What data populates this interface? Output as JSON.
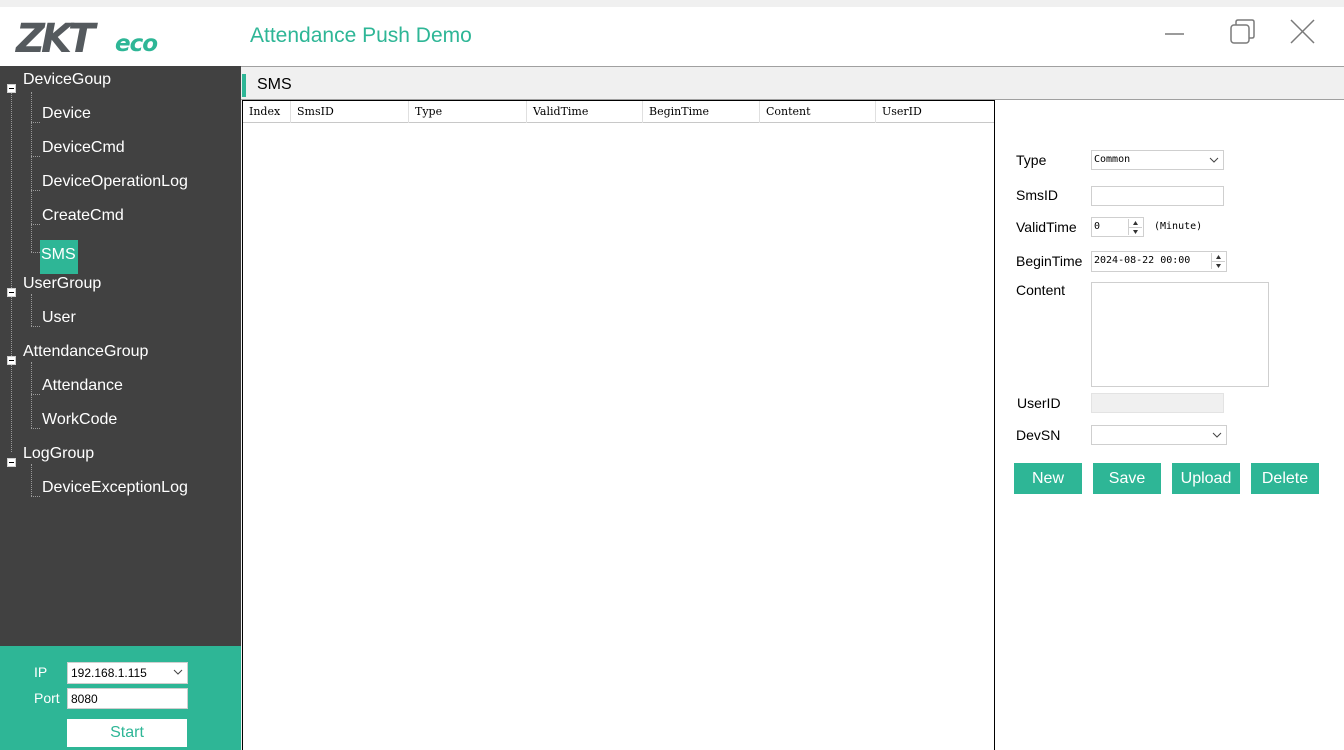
{
  "app": {
    "logo_main": "ZKT",
    "logo_sub": "eco",
    "title": "Attendance Push Demo"
  },
  "sidebar": {
    "groups": [
      {
        "label": "DeviceGoup",
        "items": [
          "Device",
          "DeviceCmd",
          "DeviceOperationLog",
          "CreateCmd",
          "SMS"
        ]
      },
      {
        "label": "UserGroup",
        "items": [
          "User"
        ]
      },
      {
        "label": "AttendanceGroup",
        "items": [
          "Attendance",
          "WorkCode"
        ]
      },
      {
        "label": "LogGroup",
        "items": [
          "DeviceExceptionLog"
        ]
      }
    ],
    "selected": "SMS"
  },
  "connection": {
    "ip_label": "IP",
    "ip_value": "192.168.1.115",
    "port_label": "Port",
    "port_value": "8080",
    "start_label": "Start"
  },
  "main": {
    "title": "SMS",
    "columns": [
      "Index",
      "SmsID",
      "Type",
      "ValidTime",
      "BeginTime",
      "Content",
      "UserID"
    ],
    "rows": []
  },
  "form": {
    "type_label": "Type",
    "type_value": "Common",
    "smsid_label": "SmsID",
    "smsid_value": "",
    "validtime_label": "ValidTime",
    "validtime_value": "0",
    "validtime_unit": "(Minute)",
    "begintime_label": "BeginTime",
    "begintime_value": "2024-08-22 00:00",
    "content_label": "Content",
    "content_value": "",
    "userid_label": "UserID",
    "userid_value": "",
    "devsn_label": "DevSN",
    "devsn_value": ""
  },
  "actions": {
    "new_label": "New",
    "save_label": "Save",
    "upload_label": "Upload",
    "delete_label": "Delete"
  },
  "colors": {
    "accent": "#2eb696",
    "sidebar_bg": "#414141",
    "logo_gray": "#555a5e"
  },
  "icons": [
    "minimize-icon",
    "restore-icon",
    "close-icon",
    "chevron-down-icon",
    "spin-up-icon",
    "spin-down-icon",
    "collapse-icon"
  ]
}
